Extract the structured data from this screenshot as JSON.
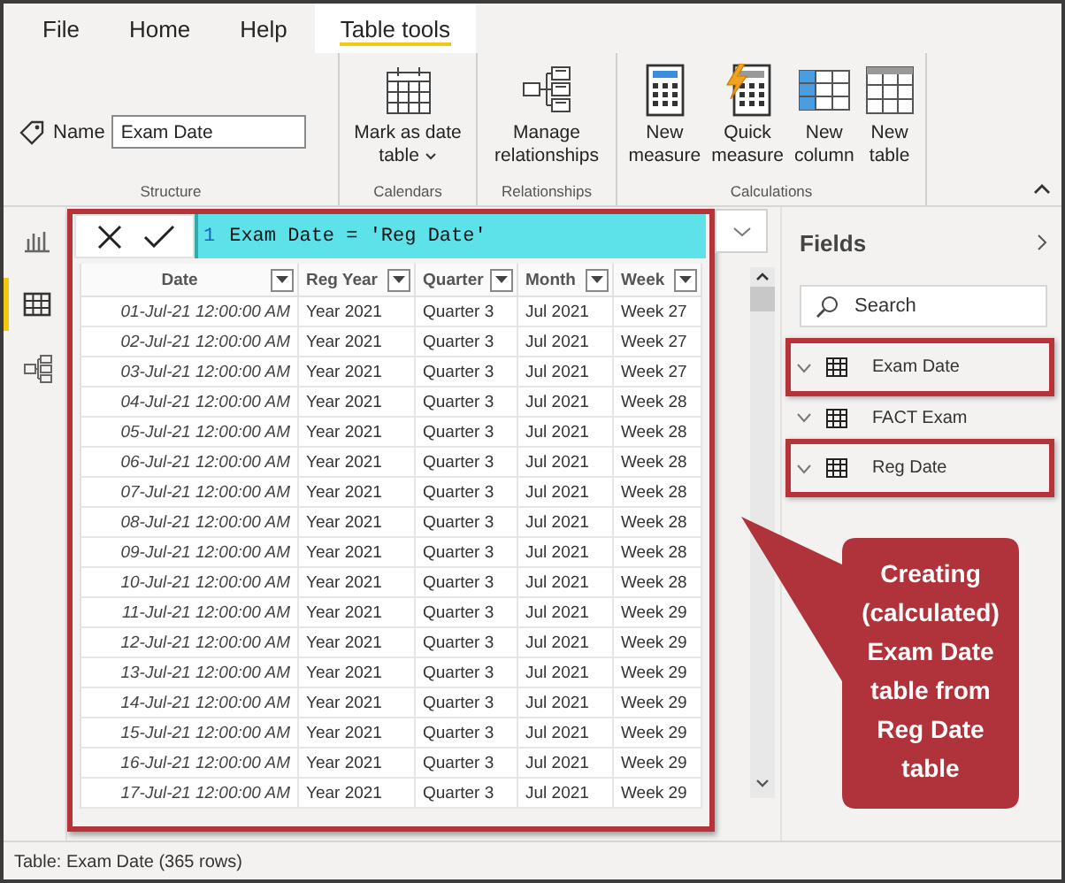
{
  "ribbon": {
    "tabs": [
      {
        "label": "File",
        "selected": false
      },
      {
        "label": "Home",
        "selected": false
      },
      {
        "label": "Help",
        "selected": false
      },
      {
        "label": "Table tools",
        "selected": true
      }
    ],
    "groups": [
      {
        "label": "Structure",
        "kind": "name",
        "name_field": {
          "label": "Name",
          "value": "Exam Date"
        }
      },
      {
        "label": "Calendars",
        "kind": "buttons",
        "buttons": [
          {
            "label_lines": [
              "Mark as date",
              "table"
            ],
            "dropdown": true
          }
        ]
      },
      {
        "label": "Relationships",
        "kind": "buttons",
        "buttons": [
          {
            "label_lines": [
              "Manage",
              "relationships"
            ],
            "dropdown": false
          }
        ]
      },
      {
        "label": "Calculations",
        "kind": "buttons",
        "buttons": [
          {
            "label_lines": [
              "New",
              "measure"
            ],
            "dropdown": false
          },
          {
            "label_lines": [
              "Quick",
              "measure"
            ],
            "dropdown": false
          },
          {
            "label_lines": [
              "New",
              "column"
            ],
            "dropdown": false
          },
          {
            "label_lines": [
              "New",
              "table"
            ],
            "dropdown": false
          }
        ]
      }
    ]
  },
  "nav": [
    {
      "kind": "report",
      "selected": false
    },
    {
      "kind": "data",
      "selected": true
    },
    {
      "kind": "model",
      "selected": false
    }
  ],
  "formula": {
    "line_number": "1",
    "text": "Exam Date = 'Reg Date'"
  },
  "table": {
    "highlighted": true,
    "columns": [
      "Date",
      "Reg Year",
      "Quarter",
      "Month",
      "Week"
    ],
    "rows": [
      [
        "01-Jul-21 12:00:00 AM",
        "Year 2021",
        "Quarter 3",
        "Jul 2021",
        "Week 27"
      ],
      [
        "02-Jul-21 12:00:00 AM",
        "Year 2021",
        "Quarter 3",
        "Jul 2021",
        "Week 27"
      ],
      [
        "03-Jul-21 12:00:00 AM",
        "Year 2021",
        "Quarter 3",
        "Jul 2021",
        "Week 27"
      ],
      [
        "04-Jul-21 12:00:00 AM",
        "Year 2021",
        "Quarter 3",
        "Jul 2021",
        "Week 28"
      ],
      [
        "05-Jul-21 12:00:00 AM",
        "Year 2021",
        "Quarter 3",
        "Jul 2021",
        "Week 28"
      ],
      [
        "06-Jul-21 12:00:00 AM",
        "Year 2021",
        "Quarter 3",
        "Jul 2021",
        "Week 28"
      ],
      [
        "07-Jul-21 12:00:00 AM",
        "Year 2021",
        "Quarter 3",
        "Jul 2021",
        "Week 28"
      ],
      [
        "08-Jul-21 12:00:00 AM",
        "Year 2021",
        "Quarter 3",
        "Jul 2021",
        "Week 28"
      ],
      [
        "09-Jul-21 12:00:00 AM",
        "Year 2021",
        "Quarter 3",
        "Jul 2021",
        "Week 28"
      ],
      [
        "10-Jul-21 12:00:00 AM",
        "Year 2021",
        "Quarter 3",
        "Jul 2021",
        "Week 28"
      ],
      [
        "11-Jul-21 12:00:00 AM",
        "Year 2021",
        "Quarter 3",
        "Jul 2021",
        "Week 29"
      ],
      [
        "12-Jul-21 12:00:00 AM",
        "Year 2021",
        "Quarter 3",
        "Jul 2021",
        "Week 29"
      ],
      [
        "13-Jul-21 12:00:00 AM",
        "Year 2021",
        "Quarter 3",
        "Jul 2021",
        "Week 29"
      ],
      [
        "14-Jul-21 12:00:00 AM",
        "Year 2021",
        "Quarter 3",
        "Jul 2021",
        "Week 29"
      ],
      [
        "15-Jul-21 12:00:00 AM",
        "Year 2021",
        "Quarter 3",
        "Jul 2021",
        "Week 29"
      ],
      [
        "16-Jul-21 12:00:00 AM",
        "Year 2021",
        "Quarter 3",
        "Jul 2021",
        "Week 29"
      ],
      [
        "17-Jul-21 12:00:00 AM",
        "Year 2021",
        "Quarter 3",
        "Jul 2021",
        "Week 29"
      ]
    ]
  },
  "fields": {
    "title": "Fields",
    "search": {
      "placeholder": "Search"
    },
    "tables": [
      {
        "name": "Exam Date",
        "highlighted": true
      },
      {
        "name": "FACT Exam",
        "highlighted": false
      },
      {
        "name": "Reg Date",
        "highlighted": true
      }
    ]
  },
  "callout": {
    "text": "Creating (calculated) Exam Date table from Reg Date table"
  },
  "status_bar": {
    "text": "Table: Exam Date (365 rows)"
  }
}
